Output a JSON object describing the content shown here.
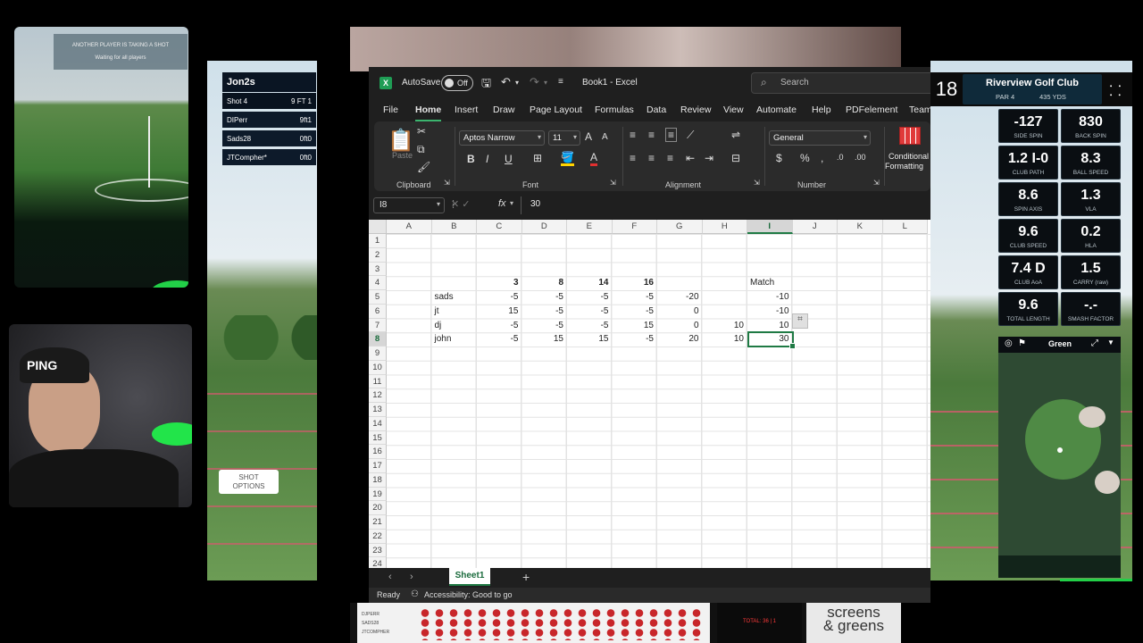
{
  "stream": {
    "top_cam": {
      "banner_line1": "ANOTHER PLAYER IS TAKING A SHOT",
      "banner_line2": "Waiting for all players"
    },
    "cap_logo": "PING",
    "leaderboard": {
      "title": "Jon2s",
      "rows": [
        {
          "name": "Shot 4",
          "value": "9 FT 1"
        },
        {
          "name": "DIPerr",
          "value": "9ft1"
        },
        {
          "name": "Sads28",
          "value": "0ft0"
        },
        {
          "name": "JTCompher*",
          "value": "0ft0"
        }
      ]
    },
    "shot_options": "SHOT\nOPTIONS",
    "score_strip_labels": [
      "DJPERR",
      "SADS28",
      "JTCOMPHER"
    ],
    "total_label": "TOTAL: 36 | 1",
    "sponsor": "screens\n& greens"
  },
  "excel": {
    "app_icon": "X",
    "autosave_label": "AutoSave",
    "autosave_state": "Off",
    "title": "Book1 - Excel",
    "search_placeholder": "Search",
    "tabs": [
      "File",
      "Home",
      "Insert",
      "Draw",
      "Page Layout",
      "Formulas",
      "Data",
      "Review",
      "View",
      "Automate",
      "Help",
      "PDFelement",
      "Team"
    ],
    "active_tab": "Home",
    "ribbon": {
      "groups": [
        "Clipboard",
        "Font",
        "Alignment",
        "Number"
      ],
      "paste": "Paste",
      "font_name": "Aptos Narrow",
      "font_size": "11",
      "number_format": "General",
      "conditional": "Conditional",
      "formatting": "Formatting"
    },
    "name_box": "I8",
    "fx": "fx",
    "formula_value": "30",
    "columns": [
      "A",
      "B",
      "C",
      "D",
      "E",
      "F",
      "G",
      "H",
      "I",
      "J",
      "K",
      "L"
    ],
    "selected_column": "I",
    "rows": [
      "1",
      "2",
      "3",
      "4",
      "5",
      "6",
      "7",
      "8",
      "9",
      "10",
      "11",
      "12",
      "13",
      "14",
      "15",
      "16",
      "17",
      "18",
      "19",
      "20",
      "21",
      "22",
      "23",
      "24"
    ],
    "selected_row": "8",
    "cells": {
      "c4": "3",
      "d4": "8",
      "e4": "14",
      "f4": "16",
      "i4": "Match",
      "b5": "sads",
      "c5": "-5",
      "d5": "-5",
      "e5": "-5",
      "f5": "-5",
      "g5": "-20",
      "i5": "-10",
      "b6": "jt",
      "c6": "15",
      "d6": "-5",
      "e6": "-5",
      "f6": "-5",
      "g6": "0",
      "i6": "-10",
      "b7": "dj",
      "c7": "-5",
      "d7": "-5",
      "e7": "-5",
      "f7": "15",
      "g7": "0",
      "h7": "10",
      "i7": "10",
      "b8": "john",
      "c8": "-5",
      "d8": "15",
      "e8": "15",
      "f8": "-5",
      "g8": "20",
      "h8": "10",
      "i8": "30"
    },
    "sheet_tab": "Sheet1",
    "status_ready": "Ready",
    "status_accessibility": "Accessibility: Good to go"
  },
  "golf": {
    "hole": "18",
    "course": "Riverview Golf Club",
    "par": "PAR 4",
    "yards": "435 YDS",
    "stats": [
      {
        "value": "-127",
        "label": "SIDE SPIN"
      },
      {
        "value": "830",
        "label": "BACK SPIN"
      },
      {
        "value": "1.2 I-0",
        "label": "CLUB PATH"
      },
      {
        "value": "8.3",
        "label": "BALL SPEED"
      },
      {
        "value": "8.6",
        "label": "SPIN AXIS"
      },
      {
        "value": "1.3",
        "label": "VLA"
      },
      {
        "value": "9.6",
        "label": "CLUB SPEED"
      },
      {
        "value": "0.2",
        "label": "HLA"
      },
      {
        "value": "7.4 D",
        "label": "CLUB AoA"
      },
      {
        "value": "1.5",
        "label": "CARRY (raw)"
      },
      {
        "value": "9.6",
        "label": "TOTAL LENGTH"
      },
      {
        "value": "-.-",
        "label": "SMASH FACTOR"
      }
    ],
    "map_title": "Green"
  }
}
